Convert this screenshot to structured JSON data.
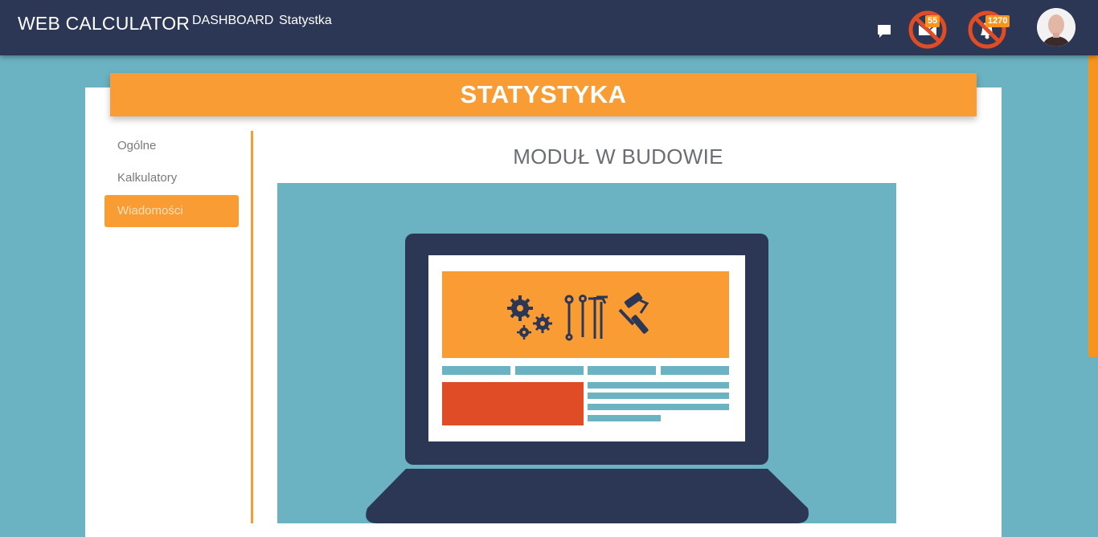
{
  "navbar": {
    "brand": "WEB CALCULATOR",
    "links": [
      "DASHBOARD",
      "Statystka"
    ],
    "mail_badge": "55",
    "bell_badge": "1270"
  },
  "page": {
    "title": "STATYSTYKA",
    "module_title": "MODUŁ W BUDOWIE"
  },
  "sidebar": {
    "items": [
      {
        "label": "Ogólne",
        "active": false
      },
      {
        "label": "Kalkulatory",
        "active": false
      },
      {
        "label": "Wiadomości",
        "active": true
      }
    ]
  },
  "colors": {
    "navbar": "#2c3755",
    "accent": "#f89c33",
    "background": "#6bb2c2",
    "laptop": "#2c3755",
    "illustration_red": "#e04c25"
  },
  "icons": [
    "chat-icon",
    "mail-icon",
    "bell-icon",
    "avatar"
  ]
}
